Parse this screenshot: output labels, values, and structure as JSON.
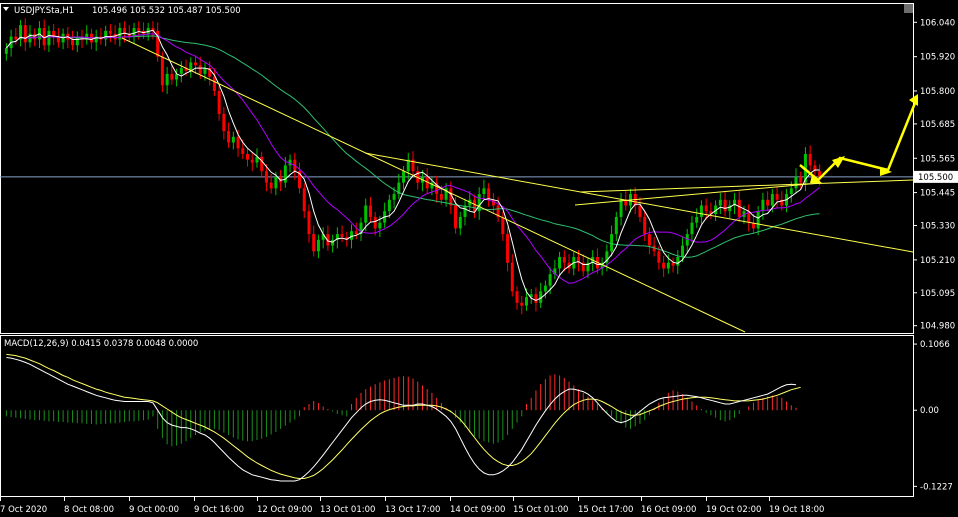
{
  "header": {
    "symbol": "USDJPY.Sta,H1",
    "ohlc": "105.496 105.532 105.487 105.500",
    "dropdown_icon": "triangle-down-icon",
    "corner_icon": "chart-shift-icon"
  },
  "macd_header": "MACD(12,26,9) 0.0415 0.0378 0.0048 0.0000",
  "colors": {
    "background": "#000000",
    "bull": "#00c000",
    "bear": "#ff0000",
    "trend": "#ffff4d",
    "arrow": "#ffff00",
    "ma_fast": "#ffffff",
    "ma_mid": "#b000ff",
    "ma_slow": "#2fbf6f",
    "hline": "#8aa2c8",
    "macd_line": "#ffffff",
    "signal_line": "#ffff66",
    "hist_pos": "#ff2a2a",
    "hist_neg": "#1a8f1a"
  },
  "chart_data": [
    {
      "type": "candlestick",
      "title": "USDJPY.Sta,H1",
      "y_ticks": [
        "106.040",
        "105.920",
        "105.800",
        "105.685",
        "105.565",
        "105.445",
        "105.330",
        "105.210",
        "105.095",
        "104.980"
      ],
      "current_price": "105.500",
      "x_ticks": [
        "7 Oct 2020",
        "8 Oct 08:00",
        "9 Oct 00:00",
        "9 Oct 16:00",
        "12 Oct 09:00",
        "13 Oct 01:00",
        "13 Oct 17:00",
        "14 Oct 09:00",
        "15 Oct 01:00",
        "15 Oct 17:00",
        "16 Oct 09:00",
        "19 Oct 02:00",
        "19 Oct 18:00"
      ],
      "ylim": [
        104.965,
        106.09
      ],
      "closes": [
        105.95,
        105.99,
        105.98,
        106.03,
        105.97,
        106.0,
        105.98,
        106.02,
        105.96,
        106.01,
        105.99,
        105.97,
        106.0,
        105.98,
        105.96,
        105.99,
        105.98,
        106.0,
        105.97,
        105.99,
        105.98,
        106.01,
        106.0,
        105.98,
        106.02,
        106.0,
        105.99,
        106.02,
        106.01,
        106.0,
        106.02,
        106.01,
        105.92,
        105.82,
        105.86,
        105.84,
        105.86,
        105.88,
        105.87,
        105.9,
        105.89,
        105.86,
        105.88,
        105.85,
        105.8,
        105.72,
        105.66,
        105.62,
        105.64,
        105.6,
        105.58,
        105.56,
        105.55,
        105.57,
        105.52,
        105.48,
        105.46,
        105.5,
        105.48,
        105.54,
        105.56,
        105.52,
        105.46,
        105.38,
        105.3,
        105.24,
        105.28,
        105.3,
        105.26,
        105.28,
        105.3,
        105.29,
        105.28,
        105.31,
        105.3,
        105.34,
        105.4,
        105.36,
        105.32,
        105.34,
        105.38,
        105.42,
        105.44,
        105.48,
        105.52,
        105.56,
        105.52,
        105.48,
        105.5,
        105.46,
        105.48,
        105.44,
        105.42,
        105.46,
        105.4,
        105.32,
        105.36,
        105.4,
        105.42,
        105.38,
        105.44,
        105.46,
        105.42,
        105.4,
        105.36,
        105.3,
        105.2,
        105.1,
        105.06,
        105.05,
        105.08,
        105.09,
        105.06,
        105.1,
        105.12,
        105.16,
        105.18,
        105.22,
        105.2,
        105.18,
        105.22,
        105.2,
        105.17,
        105.2,
        105.22,
        105.18,
        105.2,
        105.24,
        105.3,
        105.36,
        105.42,
        105.4,
        105.44,
        105.4,
        105.36,
        105.3,
        105.26,
        105.24,
        105.2,
        105.18,
        105.2,
        105.19,
        105.22,
        105.26,
        105.3,
        105.34,
        105.36,
        105.4,
        105.38,
        105.37,
        105.4,
        105.42,
        105.38,
        105.4,
        105.42,
        105.36,
        105.38,
        105.34,
        105.32,
        105.38,
        105.42,
        105.4,
        105.44,
        105.42,
        105.4,
        105.44,
        105.46,
        105.5,
        105.48,
        105.58,
        105.54,
        105.52,
        105.5
      ]
    },
    {
      "type": "bar",
      "title": "MACD(12,26,9)",
      "values_text": "0.0415 0.0378 0.0048 0.0000",
      "y_ticks": [
        "0.1066",
        "0.00",
        "-0.1227"
      ],
      "ylim": [
        -0.135,
        0.118
      ],
      "histogram": [
        -0.01,
        -0.011,
        -0.012,
        -0.013,
        -0.014,
        -0.015,
        -0.016,
        -0.016,
        -0.017,
        -0.018,
        -0.018,
        -0.019,
        -0.019,
        -0.02,
        -0.02,
        -0.021,
        -0.021,
        -0.022,
        -0.022,
        -0.023,
        -0.022,
        -0.022,
        -0.021,
        -0.021,
        -0.02,
        -0.019,
        -0.018,
        -0.018,
        -0.017,
        -0.016,
        -0.015,
        -0.01,
        -0.03,
        -0.045,
        -0.055,
        -0.058,
        -0.057,
        -0.054,
        -0.05,
        -0.045,
        -0.04,
        -0.036,
        -0.033,
        -0.031,
        -0.03,
        -0.032,
        -0.036,
        -0.04,
        -0.044,
        -0.047,
        -0.049,
        -0.05,
        -0.05,
        -0.048,
        -0.046,
        -0.043,
        -0.039,
        -0.035,
        -0.03,
        -0.025,
        -0.02,
        -0.015,
        -0.01,
        0.005,
        0.01,
        0.015,
        0.012,
        0.006,
        0.002,
        -0.002,
        -0.006,
        -0.008,
        -0.01,
        0.01,
        0.02,
        0.028,
        0.034,
        0.038,
        0.042,
        0.045,
        0.048,
        0.05,
        0.052,
        0.054,
        0.055,
        0.054,
        0.051,
        0.046,
        0.04,
        0.034,
        0.028,
        0.02,
        0.012,
        0.004,
        -0.004,
        -0.012,
        -0.02,
        -0.028,
        -0.036,
        -0.042,
        -0.046,
        -0.05,
        -0.052,
        -0.054,
        -0.052,
        -0.048,
        -0.04,
        -0.03,
        -0.02,
        -0.01,
        0.01,
        0.02,
        0.032,
        0.042,
        0.05,
        0.056,
        0.058,
        0.056,
        0.052,
        0.046,
        0.04,
        0.034,
        0.028,
        0.022,
        0.016,
        0.01,
        0.004,
        -0.004,
        -0.01,
        -0.016,
        -0.022,
        -0.028,
        -0.03,
        -0.026,
        -0.022,
        -0.016,
        -0.008,
        0.004,
        0.012,
        0.02,
        0.028,
        0.032,
        0.03,
        0.026,
        0.02,
        0.014,
        0.008,
        0.002,
        -0.004,
        -0.008,
        -0.012,
        -0.016,
        -0.018,
        -0.016,
        -0.012,
        -0.006,
        0.0,
        0.006,
        0.012,
        0.016,
        0.02,
        0.022,
        0.024,
        0.022,
        0.02,
        0.014,
        0.008,
        0.004
      ],
      "macd": [
        0.085,
        0.084,
        0.082,
        0.08,
        0.077,
        0.074,
        0.07,
        0.066,
        0.062,
        0.058,
        0.054,
        0.05,
        0.046,
        0.042,
        0.039,
        0.036,
        0.033,
        0.03,
        0.027,
        0.024,
        0.022,
        0.02,
        0.018,
        0.016,
        0.015,
        0.014,
        0.014,
        0.014,
        0.014,
        0.014,
        0.014,
        0.012,
        0.0,
        -0.012,
        -0.02,
        -0.024,
        -0.026,
        -0.028,
        -0.028,
        -0.03,
        -0.033,
        -0.037,
        -0.04,
        -0.045,
        -0.052,
        -0.06,
        -0.068,
        -0.076,
        -0.083,
        -0.09,
        -0.096,
        -0.1,
        -0.104,
        -0.106,
        -0.108,
        -0.11,
        -0.112,
        -0.113,
        -0.114,
        -0.114,
        -0.114,
        -0.114,
        -0.112,
        -0.106,
        -0.099,
        -0.091,
        -0.082,
        -0.072,
        -0.062,
        -0.052,
        -0.042,
        -0.032,
        -0.022,
        -0.012,
        -0.004,
        0.004,
        0.01,
        0.014,
        0.016,
        0.017,
        0.016,
        0.014,
        0.012,
        0.01,
        0.008,
        0.008,
        0.008,
        0.01,
        0.01,
        0.008,
        0.006,
        0.002,
        -0.004,
        -0.01,
        -0.018,
        -0.03,
        -0.045,
        -0.06,
        -0.074,
        -0.086,
        -0.095,
        -0.101,
        -0.104,
        -0.104,
        -0.102,
        -0.098,
        -0.092,
        -0.084,
        -0.074,
        -0.063,
        -0.05,
        -0.037,
        -0.024,
        -0.012,
        -0.001,
        0.009,
        0.018,
        0.025,
        0.03,
        0.034,
        0.034,
        0.032,
        0.03,
        0.026,
        0.02,
        0.012,
        0.003,
        -0.005,
        -0.012,
        -0.018,
        -0.02,
        -0.018,
        -0.014,
        -0.008,
        -0.002,
        0.004,
        0.01,
        0.014,
        0.018,
        0.02,
        0.021,
        0.022,
        0.023,
        0.024,
        0.024,
        0.023,
        0.022,
        0.02,
        0.018,
        0.016,
        0.014,
        0.012,
        0.01,
        0.01,
        0.012,
        0.014,
        0.016,
        0.018,
        0.02,
        0.022,
        0.024,
        0.026,
        0.03,
        0.034,
        0.038,
        0.041,
        0.042,
        0.041
      ],
      "signal": [
        0.09,
        0.089,
        0.088,
        0.086,
        0.084,
        0.081,
        0.078,
        0.075,
        0.071,
        0.067,
        0.064,
        0.06,
        0.056,
        0.053,
        0.049,
        0.046,
        0.043,
        0.04,
        0.037,
        0.034,
        0.032,
        0.029,
        0.027,
        0.025,
        0.023,
        0.021,
        0.02,
        0.019,
        0.018,
        0.017,
        0.016,
        0.015,
        0.012,
        0.007,
        0.002,
        -0.003,
        -0.008,
        -0.012,
        -0.015,
        -0.018,
        -0.021,
        -0.024,
        -0.027,
        -0.031,
        -0.035,
        -0.04,
        -0.045,
        -0.051,
        -0.057,
        -0.063,
        -0.069,
        -0.075,
        -0.08,
        -0.085,
        -0.089,
        -0.093,
        -0.097,
        -0.1,
        -0.103,
        -0.105,
        -0.107,
        -0.109,
        -0.11,
        -0.11,
        -0.108,
        -0.105,
        -0.1,
        -0.094,
        -0.087,
        -0.08,
        -0.072,
        -0.064,
        -0.055,
        -0.047,
        -0.039,
        -0.031,
        -0.024,
        -0.017,
        -0.011,
        -0.006,
        -0.002,
        0.001,
        0.003,
        0.005,
        0.006,
        0.007,
        0.007,
        0.008,
        0.008,
        0.008,
        0.008,
        0.007,
        0.005,
        0.002,
        -0.002,
        -0.008,
        -0.015,
        -0.024,
        -0.034,
        -0.044,
        -0.054,
        -0.063,
        -0.071,
        -0.078,
        -0.083,
        -0.087,
        -0.089,
        -0.089,
        -0.087,
        -0.083,
        -0.077,
        -0.07,
        -0.061,
        -0.051,
        -0.041,
        -0.031,
        -0.021,
        -0.012,
        -0.004,
        0.003,
        0.009,
        0.013,
        0.016,
        0.018,
        0.018,
        0.017,
        0.014,
        0.01,
        0.006,
        0.001,
        -0.003,
        -0.006,
        -0.008,
        -0.008,
        -0.007,
        -0.004,
        -0.001,
        0.002,
        0.006,
        0.009,
        0.012,
        0.014,
        0.016,
        0.018,
        0.019,
        0.02,
        0.021,
        0.021,
        0.021,
        0.02,
        0.019,
        0.018,
        0.017,
        0.016,
        0.015,
        0.015,
        0.015,
        0.015,
        0.016,
        0.017,
        0.018,
        0.02,
        0.022,
        0.024,
        0.027,
        0.03,
        0.033,
        0.035,
        0.037
      ]
    }
  ]
}
